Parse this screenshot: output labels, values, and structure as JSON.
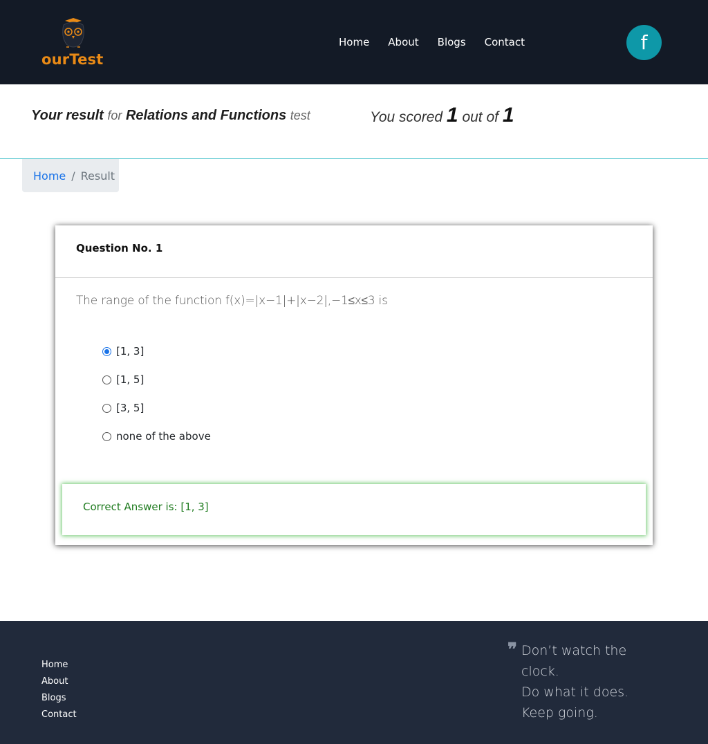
{
  "header": {
    "logo_text": "ourTest",
    "nav": [
      "Home",
      "About",
      "Blogs",
      "Contact"
    ],
    "social_icon": "facebook-icon",
    "social_glyph": "f"
  },
  "result": {
    "prefix": "Your result",
    "for_word": "for",
    "test_name": "Relations and Functions",
    "test_word": "test",
    "scored_label": "You scored",
    "score": "1",
    "out_of_label": "out of",
    "total": "1"
  },
  "breadcrumb": {
    "home": "Home",
    "separator": "/",
    "current": "Result"
  },
  "question": {
    "heading": "Question No. 1",
    "text": "The range of the function f(x)=|x−1|+|x−2|,−1≤x≤3 is",
    "options": [
      "[1, 3]",
      "[1, 5]",
      "[3, 5]",
      "none of the above"
    ],
    "selected_index": 0,
    "correct_answer": "Correct Answer is: [1, 3]"
  },
  "footer": {
    "links": [
      "Home",
      "About",
      "Blogs",
      "Contact"
    ],
    "quote_mark": "❞",
    "quote": "Don’t watch the\nclock.\nDo what it does.\nKeep going."
  },
  "colors": {
    "header_bg": "#131a26",
    "logo_orange": "#e98a16",
    "facebook_teal": "#0e98a8",
    "link_blue": "#1a73e8",
    "correct_green": "#1d7a1d",
    "footer_bg": "#212a3b"
  }
}
